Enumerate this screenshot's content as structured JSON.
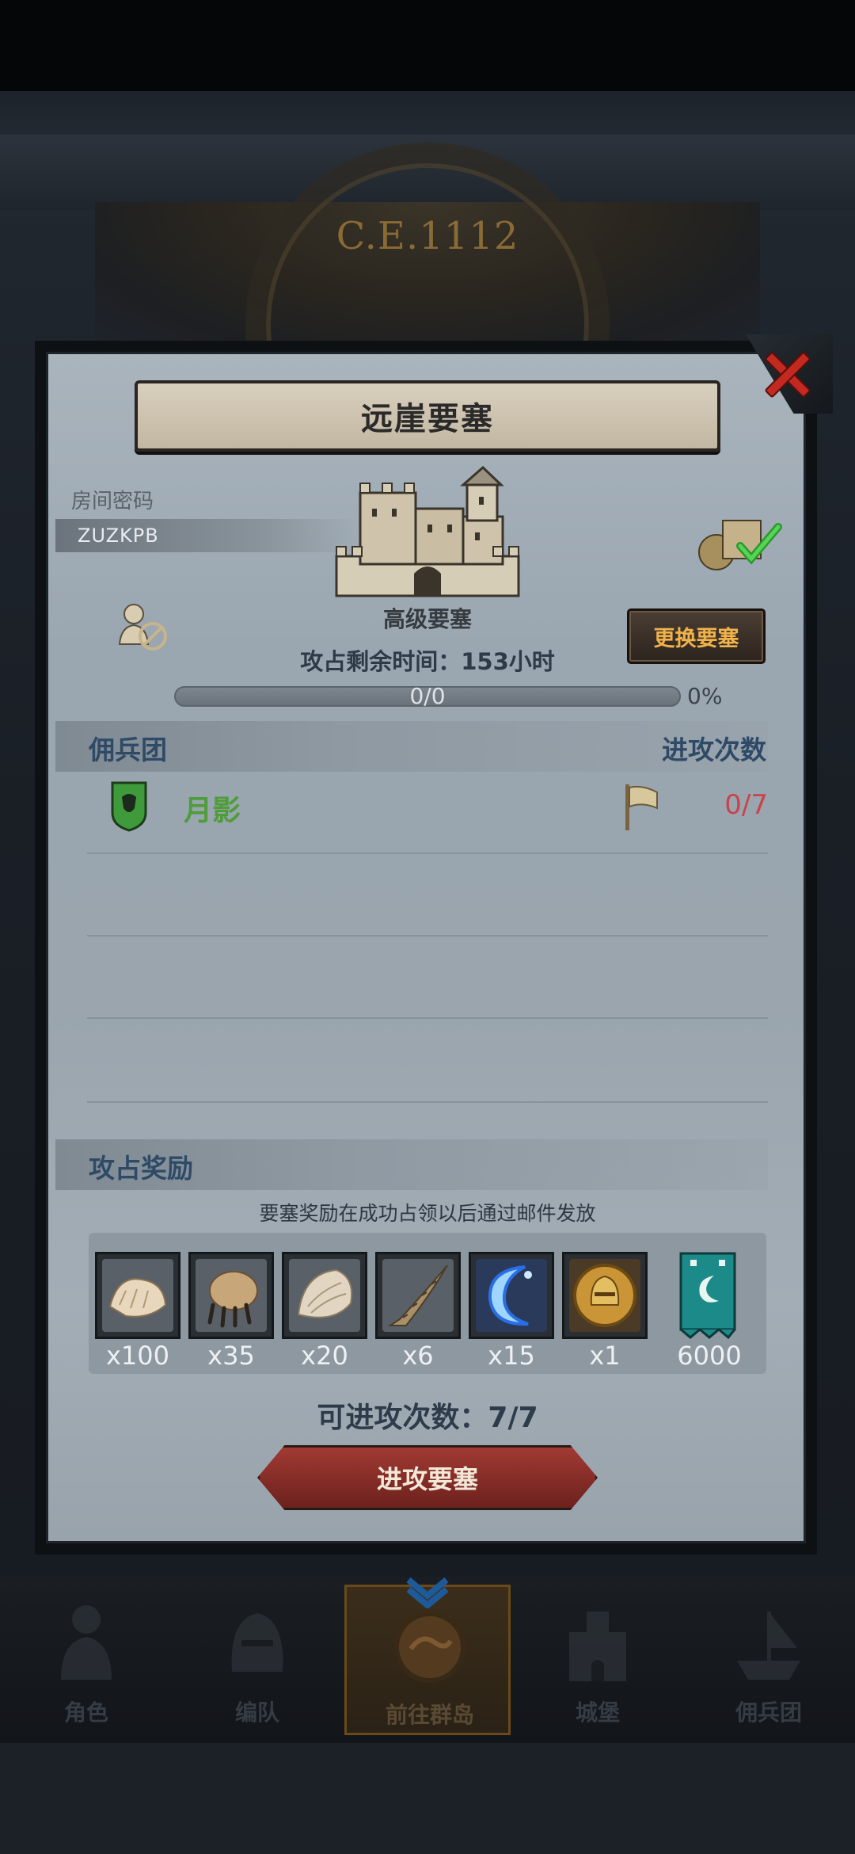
{
  "header": {
    "era": "C.E.1112"
  },
  "dialog": {
    "title": "远崖要塞",
    "room_password_label": "房间密码",
    "room_code": "ZUZKPB",
    "fortress_grade": "高级要塞",
    "change_fortress_label": "更换要塞",
    "time_remaining": "攻占剩余时间：153小时",
    "progress": {
      "text": "0/0",
      "percent": "0%",
      "fraction": 0
    },
    "columns": {
      "guild": "佣兵团",
      "attack_count": "进攻次数"
    },
    "guild_entry": {
      "name": "月影",
      "attacks": "0/7"
    },
    "rewards": {
      "title": "攻占奖励",
      "note": "要塞奖励在成功占领以后通过邮件发放",
      "items": [
        {
          "icon": "fur-pelt-icon",
          "qty": "x100"
        },
        {
          "icon": "beast-claw-icon",
          "qty": "x35"
        },
        {
          "icon": "scale-hide-icon",
          "qty": "x20"
        },
        {
          "icon": "horn-icon",
          "qty": "x6"
        },
        {
          "icon": "crescent-rune-icon",
          "qty": "x15"
        },
        {
          "icon": "golden-helmet-coin-icon",
          "qty": "x1"
        },
        {
          "icon": "guild-banner-icon",
          "qty": "6000"
        }
      ]
    },
    "attacks_available": "可进攻次数：7/7",
    "attack_button_label": "进攻要塞"
  },
  "bottom_nav": {
    "items": [
      {
        "label": "角色",
        "icon": "knight-icon"
      },
      {
        "label": "编队",
        "icon": "helmet-icon"
      },
      {
        "label": "前往群岛",
        "icon": "island-compass-icon"
      },
      {
        "label": "城堡",
        "icon": "castle-icon"
      },
      {
        "label": "佣兵团",
        "icon": "ship-icon"
      }
    ],
    "active_index": 2
  },
  "colors": {
    "accent_gold": "#f0b24a",
    "close_red": "#c22a21",
    "guild_green": "#4f9d3a",
    "count_red": "#c8434a",
    "section_blue": "#2e4a66"
  }
}
